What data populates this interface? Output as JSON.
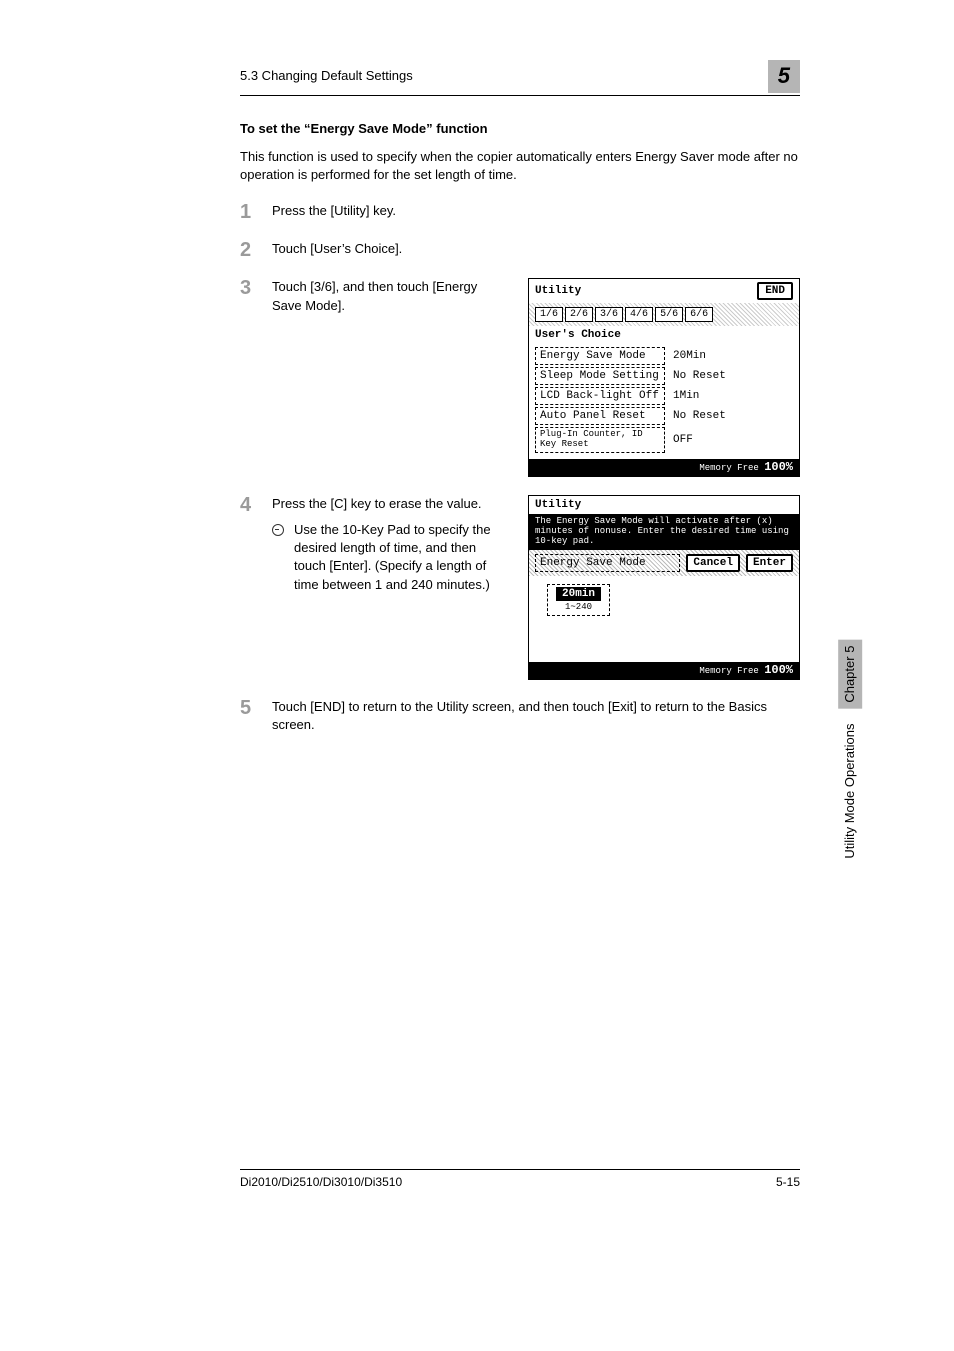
{
  "header": {
    "breadcrumb": "5.3 Changing Default Settings",
    "chapter_badge": "5"
  },
  "subheading": "To set the “Energy Save Mode” function",
  "intro": "This function is used to specify when the copier automatically enters Energy Saver mode after no operation is performed for the set length of time.",
  "steps": {
    "s1": "Press the [Utility] key.",
    "s2": "Touch [User’s Choice].",
    "s3": "Touch [3/6], and then touch [Energy Save Mode].",
    "s4_main": "Press the [C] key to erase the value.",
    "s4_sub": "Use the 10-Key Pad to specify the desired length of time, and then touch [Enter]. (Specify a length of time between 1 and 240 minutes.)",
    "s5": "Touch [END] to return to the Utility screen, and then touch [Exit] to return to the Basics screen."
  },
  "lcd1": {
    "title": "Utility",
    "end": "END",
    "user_choice": "User's Choice",
    "tabs": [
      "1/6",
      "2/6",
      "3/6",
      "4/6",
      "5/6",
      "6/6"
    ],
    "rows": [
      {
        "k": "Energy Save Mode",
        "v": "20Min"
      },
      {
        "k": "Sleep Mode Setting",
        "v": "No Reset"
      },
      {
        "k": "LCD Back-light Off",
        "v": "1Min"
      },
      {
        "k": "Auto Panel Reset",
        "v": "No Reset"
      },
      {
        "k": "Plug-In Counter, ID Key Reset",
        "v": "OFF"
      }
    ],
    "memory_label": "Memory Free",
    "memory_val": "100%"
  },
  "lcd2": {
    "title": "Utility",
    "msg": "The Energy Save Mode will activate after (x) minutes of nonuse.  Enter the desired time using 10-key pad.",
    "mode_label": "Energy Save Mode",
    "cancel": "Cancel",
    "enter": "Enter",
    "value": "20min",
    "range": "1~240",
    "memory_label": "Memory Free",
    "memory_val": "100%"
  },
  "side": {
    "chapter": "Chapter 5",
    "section": "Utility Mode Operations"
  },
  "footer": {
    "model": "Di2010/Di2510/Di3010/Di3510",
    "page": "5-15"
  }
}
